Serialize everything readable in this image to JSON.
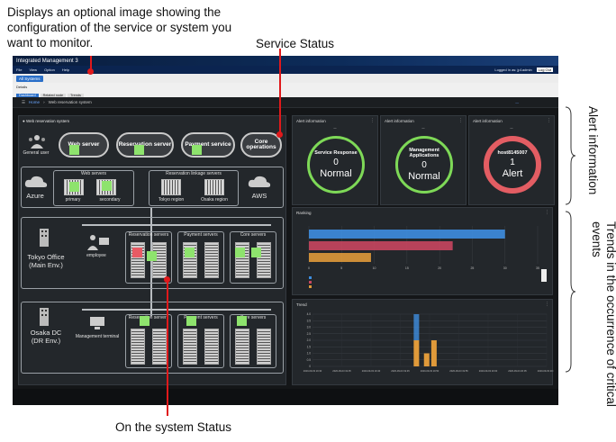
{
  "callouts": {
    "top_line1": "Displays an optional image showing the",
    "top_line2": "configuration of the service or system you",
    "top_line3": "want to monitor.",
    "service_status": "Service Status",
    "system_status": "On the system Status",
    "alert_information": "Alert information",
    "trends": "Trends in the occurrence of critical events"
  },
  "app": {
    "title": "Integrated Management 3",
    "menu": [
      "File",
      "View",
      "Option",
      "Help"
    ],
    "logged_in": "Logged in as: jp1admin",
    "logout": "Log Out",
    "all_systems_tab": "All Systems",
    "details": "Details",
    "subtabs": [
      "Dashboard",
      "Related node",
      "Trends"
    ],
    "breadcrumb_home": "Home",
    "breadcrumb_current": "Web reservation system"
  },
  "system_panel": {
    "title": "Web reservation system",
    "general_user": "General user",
    "services": [
      "Web server",
      "Reservation server",
      "Payment service",
      "Core operations"
    ],
    "azure": "Azure",
    "aws": "AWS",
    "web_servers": "Web servers",
    "primary": "primary",
    "secondary": "secondary",
    "linkage_servers": "Reservation linkage servers",
    "tokyo_region": "Tokyo region",
    "osaka_region": "Osaka region",
    "tokyo_office": "Tokyo Office",
    "main_env": "(Main Env.)",
    "employee": "employee",
    "reservation_servers": "Reservation servers",
    "payment_servers": "Payment servers",
    "core_servers": "Core servers",
    "osaka_dc": "Osaka DC",
    "dr_env": "(DR Env.)",
    "management_terminal": "Management terminal"
  },
  "alerts": [
    {
      "title": "Alert information",
      "name": "Service Response",
      "count": "0",
      "status": "Normal",
      "color": "#7ed957"
    },
    {
      "title": "Alert information",
      "name": "Management Applications",
      "count": "0",
      "status": "Normal",
      "color": "#7ed957"
    },
    {
      "title": "Alert information",
      "name": "host8145007",
      "count": "1",
      "status": "Alert",
      "color": "#e35d63"
    }
  ],
  "ranking": {
    "title": "Ranking",
    "chart_data": {
      "type": "bar",
      "orientation": "horizontal",
      "values": [
        30,
        22,
        9.5
      ],
      "colors": [
        "#3e8ee0",
        "#c8465f",
        "#e09a3a"
      ],
      "xlim": [
        0,
        35
      ],
      "xticks": [
        "0",
        "5",
        "10",
        "15",
        "20",
        "25",
        "30",
        "35"
      ]
    }
  },
  "trend": {
    "title": "Trend",
    "chart_data": {
      "type": "bar",
      "yticks": [
        "0",
        "0.5",
        "1.0",
        "1.5",
        "2.0",
        "2.5",
        "3.0",
        "3.5",
        "4.0"
      ],
      "ylim": [
        0,
        4
      ],
      "categories": [
        "2020-09-03 19:30",
        "2020-09-03 19:35",
        "2020-09-03 19:40",
        "2020-09-03 19:45",
        "2020-09-03 19:50",
        "2020-09-03 19:55",
        "2020-09-03 20:00",
        "2020-09-03 20:05",
        "2020-09-03 20:10"
      ],
      "bars": [
        {
          "x": 3.55,
          "orange": 2,
          "blue": 2
        },
        {
          "x": 3.9,
          "orange": 1,
          "blue": 0
        },
        {
          "x": 4.15,
          "orange": 2,
          "blue": 0
        }
      ]
    }
  }
}
